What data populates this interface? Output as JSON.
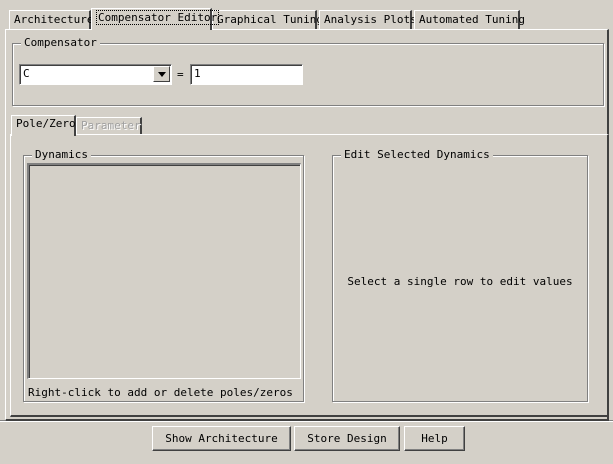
{
  "tabs": [
    {
      "label": "Architecture"
    },
    {
      "label": "Compensator Editor"
    },
    {
      "label": "Graphical Tuning"
    },
    {
      "label": "Analysis Plots"
    },
    {
      "label": "Automated Tuning"
    }
  ],
  "active_tab": "Compensator Editor",
  "compensator": {
    "group_title": "Compensator",
    "selected": "C",
    "equals": "=",
    "value": "1"
  },
  "inner_tabs": [
    {
      "label": "Pole/Zero",
      "enabled": true
    },
    {
      "label": "Parameter",
      "enabled": false
    }
  ],
  "dynamics": {
    "group_title": "Dynamics",
    "hint": "Right-click to add or delete poles/zeros"
  },
  "edit_dynamics": {
    "group_title": "Edit Selected Dynamics",
    "message": "Select a single row to edit values"
  },
  "buttons": {
    "show_architecture": "Show Architecture",
    "store_design": "Store Design",
    "help": "Help"
  }
}
